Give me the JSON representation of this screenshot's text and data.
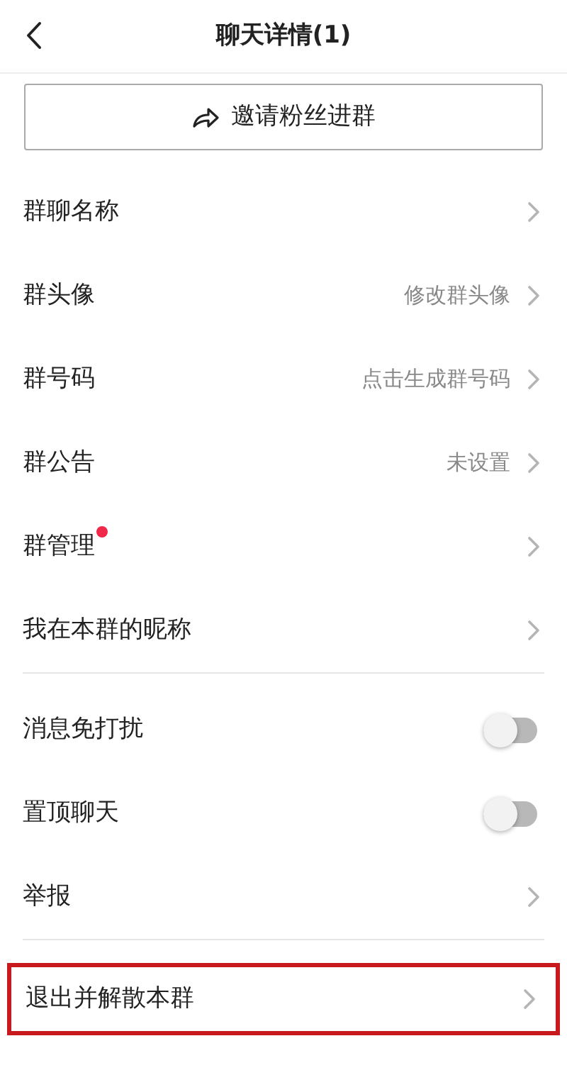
{
  "header": {
    "title": "聊天详情(1)"
  },
  "invite_button": {
    "label": "邀请粉丝进群"
  },
  "sections": [
    {
      "items": [
        {
          "kind": "link",
          "label": "群聊名称",
          "badge": false,
          "highlighted": false
        },
        {
          "kind": "link",
          "label": "群头像",
          "value": "修改群头像",
          "badge": false,
          "highlighted": false
        },
        {
          "kind": "link",
          "label": "群号码",
          "value": "点击生成群号码",
          "badge": false,
          "highlighted": false
        },
        {
          "kind": "link",
          "label": "群公告",
          "value": "未设置",
          "badge": false,
          "highlighted": false
        },
        {
          "kind": "link",
          "label": "群管理",
          "badge": true,
          "highlighted": false
        },
        {
          "kind": "link",
          "label": "我在本群的昵称",
          "badge": false,
          "highlighted": false
        }
      ]
    },
    {
      "items": [
        {
          "kind": "toggle",
          "label": "消息免打扰",
          "on": false,
          "badge": false,
          "highlighted": false
        },
        {
          "kind": "toggle",
          "label": "置顶聊天",
          "on": false,
          "badge": false,
          "highlighted": false
        },
        {
          "kind": "link",
          "label": "举报",
          "badge": false,
          "highlighted": false
        }
      ]
    },
    {
      "items": [
        {
          "kind": "link",
          "label": "退出并解散本群",
          "badge": false,
          "highlighted": true
        }
      ]
    }
  ]
}
